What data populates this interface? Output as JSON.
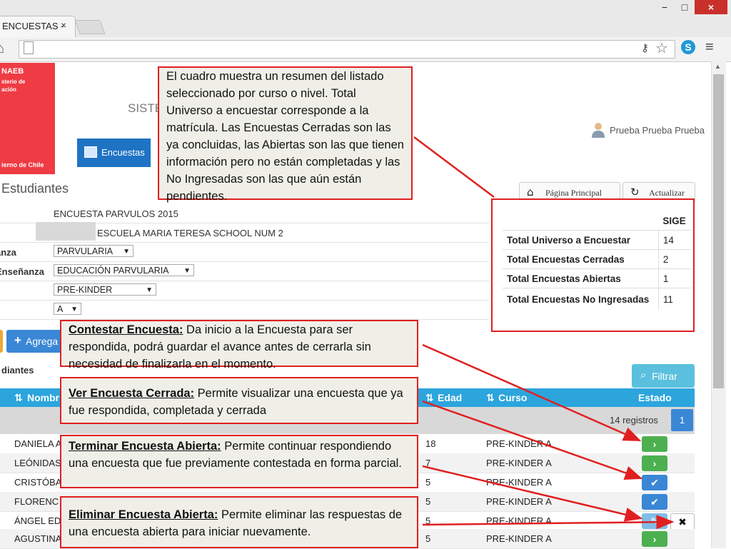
{
  "browser": {
    "tab_title": "ENCUESTAS -",
    "tab_close": "×",
    "window_controls": {
      "minimize": "−",
      "maximize": "□",
      "close": "×"
    },
    "icons": {
      "home": "home-icon",
      "key": "key-icon",
      "star": "star-icon",
      "skype": "skype-icon",
      "menu": "menu-icon"
    }
  },
  "header": {
    "logo": {
      "org": "NAEB",
      "ministry_line1": "sterio de",
      "ministry_line2": "ación",
      "government": "ierno de Chile"
    },
    "system_title": "SISTE",
    "nav_tab": "Encuestas",
    "user": "Prueba Prueba Prueba"
  },
  "page": {
    "section_title": "Estudiantes",
    "buttons": {
      "home": "Página Principal",
      "refresh": "Actualizar"
    }
  },
  "filters": {
    "survey": "ENCUESTA PARVULOS 2015",
    "school": "ESCUELA MARIA TERESA SCHOOL NUM 2",
    "label_ensenanza": "anza",
    "ensenanza": "PARVULARIA",
    "label_tipo": "Enseñanza",
    "tipo": "EDUCACIÓN PARVULARIA",
    "grado": "PRE-KINDER",
    "letra": "A"
  },
  "actions": {
    "add": "Agrega"
  },
  "list": {
    "title": "diantes",
    "filter_button": "Filtrar",
    "headers": {
      "nombre": "Nombr",
      "edad": "Edad",
      "curso": "Curso",
      "estado": "Estado"
    },
    "records": "14 registros",
    "page": "1",
    "rows": [
      {
        "name": "DANIELA A",
        "age": "18",
        "course": "PRE-KINDER A"
      },
      {
        "name": "LEÓNIDAS",
        "age": "7",
        "course": "PRE-KINDER A"
      },
      {
        "name": "CRISTÓBA",
        "age": "5",
        "course": "PRE-KINDER A"
      },
      {
        "name": "FLORENC",
        "age": "5",
        "course": "PRE-KINDER A"
      },
      {
        "name": "ÁNGEL ED",
        "age": "5",
        "course": "PRE-KINDER A"
      },
      {
        "name": "AGUSTINA",
        "age": "5",
        "course": "PRE-KINDER A"
      }
    ],
    "status_glyphs": {
      "continue": "›",
      "done": "✔",
      "edit": "✎",
      "delete": "✖"
    }
  },
  "summary": {
    "column": "SIGE",
    "rows": [
      {
        "label": "Total Universo a Encuestar",
        "value": "14"
      },
      {
        "label": "Total Encuestas Cerradas",
        "value": "2"
      },
      {
        "label": "Total Encuestas Abiertas",
        "value": "1"
      },
      {
        "label": "Total Encuestas No Ingresadas",
        "value": "11"
      }
    ]
  },
  "callouts": {
    "resumen": "El cuadro muestra un resumen del listado seleccionado por curso o nivel. Total Universo a encuestar corresponde a la matrícula. Las Encuestas Cerradas son las ya concluidas, las Abiertas son las que tienen información pero no están completadas y las No Ingresadas son las que aún están pendientes.",
    "contestar_title": "Contestar Encuesta:",
    "contestar_text": " Da inicio a la Encuesta para ser respondida, podrá guardar el avance antes de cerrarla sin necesidad de finalizarla en el momento.",
    "ver_title": "Ver Encuesta Cerrada:",
    "ver_text": " Permite visualizar una encuesta que ya fue respondida, completada y cerrada",
    "terminar_title": "Terminar Encuesta Abierta:",
    "terminar_text": " Permite continuar respondiendo una encuesta que fue previamente contestada en forma parcial.",
    "eliminar_title": "Eliminar Encuesta Abierta:",
    "eliminar_text": " Permite eliminar las respuestas de una  encuesta abierta para iniciar nuevamente."
  },
  "colors": {
    "accent": "#2ca5dd",
    "primary": "#3a87d6",
    "success": "#4cb050",
    "callout_border": "#e02020",
    "logo": "#ef3b44"
  }
}
